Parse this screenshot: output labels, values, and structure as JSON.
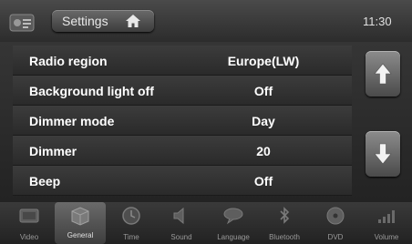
{
  "header": {
    "title": "Settings",
    "clock": "11:30",
    "app_icon": "settings-app-icon",
    "home_icon": "home-icon"
  },
  "settings": [
    {
      "label": "Radio region",
      "value": "Europe(LW)"
    },
    {
      "label": "Background light off",
      "value": "Off"
    },
    {
      "label": "Dimmer mode",
      "value": "Day"
    },
    {
      "label": "Dimmer",
      "value": "20"
    },
    {
      "label": "Beep",
      "value": "Off"
    }
  ],
  "scroll": {
    "up_icon": "arrow-up-icon",
    "down_icon": "arrow-down-icon"
  },
  "nav": [
    {
      "label": "Video",
      "icon": "video-icon",
      "active": false
    },
    {
      "label": "General",
      "icon": "general-icon",
      "active": true
    },
    {
      "label": "Time",
      "icon": "clock-icon",
      "active": false
    },
    {
      "label": "Sound",
      "icon": "speaker-icon",
      "active": false
    },
    {
      "label": "Language",
      "icon": "language-icon",
      "active": false
    },
    {
      "label": "Bluetooth",
      "icon": "bluetooth-icon",
      "active": false
    },
    {
      "label": "DVD",
      "icon": "disc-icon",
      "active": false
    },
    {
      "label": "Volume",
      "icon": "volume-icon",
      "active": false
    }
  ],
  "colors": {
    "background": "#2b2b2b",
    "text": "#ffffff",
    "accent": "#8c8c8c"
  }
}
